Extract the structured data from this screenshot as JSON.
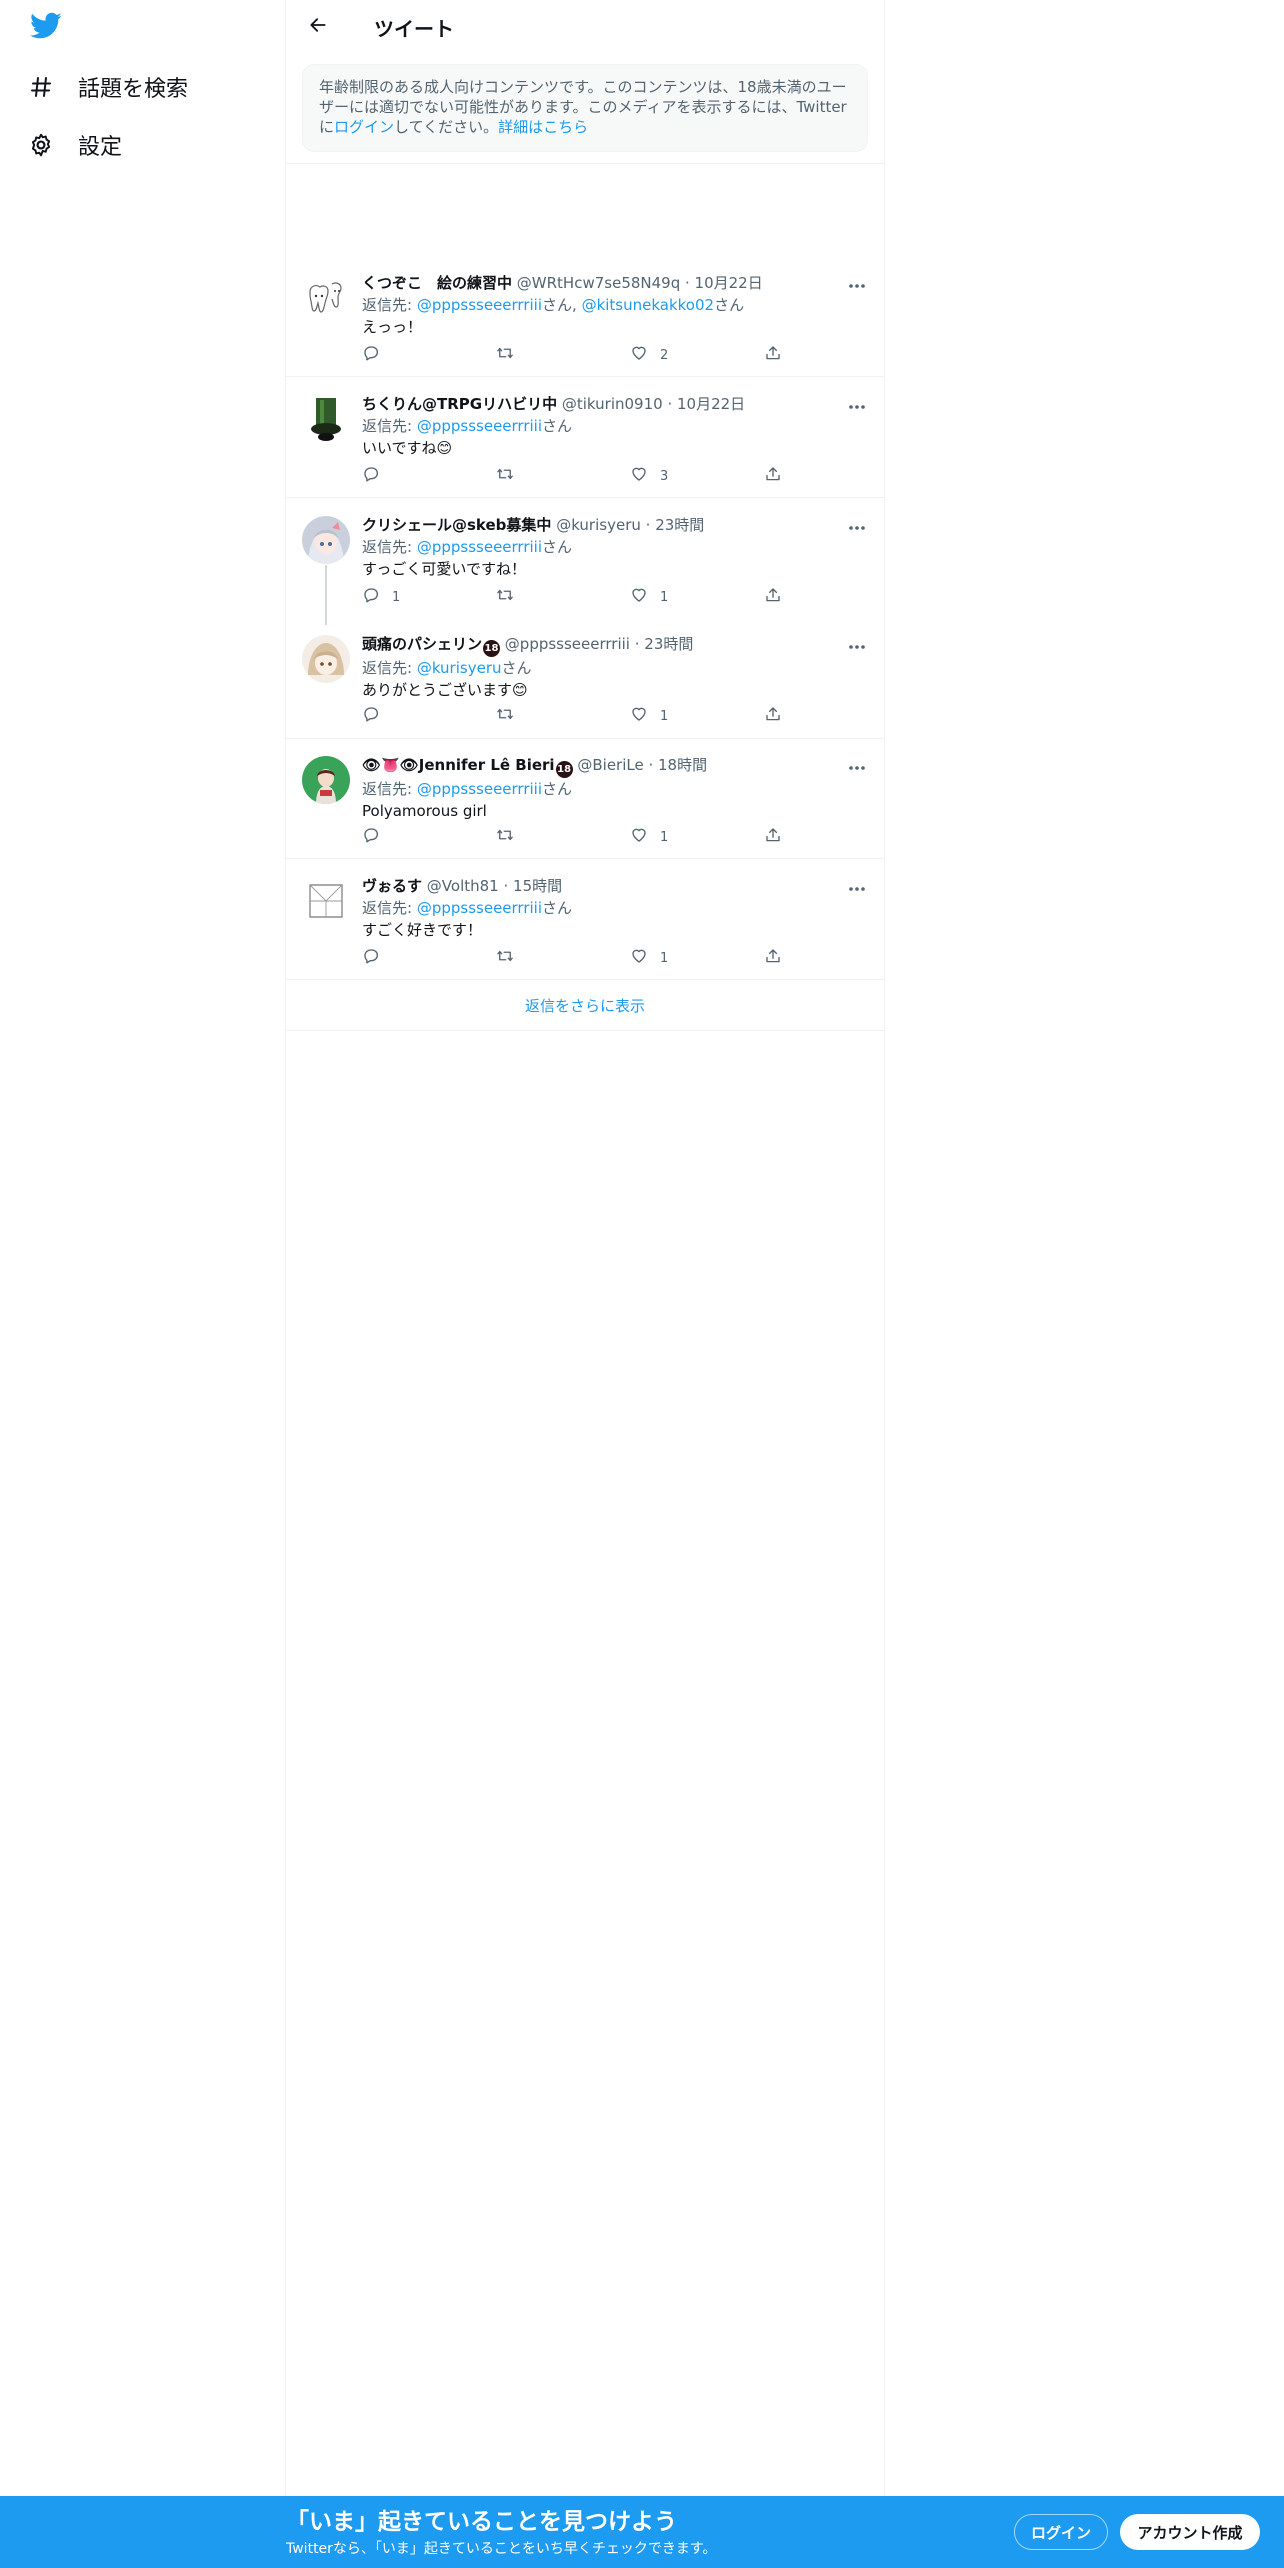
{
  "sidebar": {
    "logo": "twitter-bird-icon",
    "items": [
      {
        "icon": "hashtag-icon",
        "label": "話題を検索"
      },
      {
        "icon": "gear-icon",
        "label": "設定"
      }
    ]
  },
  "header": {
    "title": "ツイート",
    "back_icon": "arrow-left-icon"
  },
  "warning": {
    "text_a": "年齢制限のある成人向けコンテンツです。このコンテンツは、18歳未満のユー",
    "text_b": "ザーには適切でない可能性があります。このメディアを表示するには、Twitter",
    "text_c1": "に",
    "login_link": "ログイン",
    "text_c2": "してください。",
    "details_link": "詳細はこちら"
  },
  "reply_prefix": "返信先: ",
  "reply_suffix": "さん",
  "tweets": [
    {
      "name": "くつぞこ　絵の練習中",
      "handle": "@WRtHcw7se58N49q",
      "time": "10月22日",
      "mentions": [
        "@pppssseeerrriii",
        "@kitsunekakko02"
      ],
      "text": "えっっ！",
      "reply_count": "",
      "retweet_count": "",
      "like_count": "2"
    },
    {
      "name": "ちくりん@TRPGリハビリ中",
      "handle": "@tikurin0910",
      "time": "10月22日",
      "mentions": [
        "@pppssseeerrriii"
      ],
      "text": "いいですね😊",
      "reply_count": "",
      "retweet_count": "",
      "like_count": "3"
    },
    {
      "name": "クリシェール@skeb募集中",
      "handle": "@kurisyeru",
      "time": "23時間",
      "mentions": [
        "@pppssseeerrriii"
      ],
      "text": "すっごく可愛いですね！",
      "reply_count": "1",
      "retweet_count": "",
      "like_count": "1"
    },
    {
      "name": "頭痛のパシェリン",
      "badge": "18",
      "handle": "@pppssseeerrriii",
      "time": "23時間",
      "mentions": [
        "@kurisyeru"
      ],
      "text": "ありがとうございます😊",
      "reply_count": "",
      "retweet_count": "",
      "like_count": "1"
    },
    {
      "name": "👁👅👁Jennifer Lê Bieri",
      "badge": "18",
      "handle": "@BieriLe",
      "time": "18時間",
      "mentions": [
        "@pppssseeerrriii"
      ],
      "text": "Polyamorous girl",
      "reply_count": "",
      "retweet_count": "",
      "like_count": "1"
    },
    {
      "name": "ヴぉるす",
      "handle": "@Volth81",
      "time": "15時間",
      "mentions": [
        "@pppssseeerrriii"
      ],
      "text": "すごく好きです！",
      "reply_count": "",
      "retweet_count": "",
      "like_count": "1"
    }
  ],
  "show_more": "返信をさらに表示",
  "banner": {
    "title": "「いま」起きていることを見つけよう",
    "subtitle": "Twitterなら、「いま」起きていることをいち早くチェックできます。",
    "login": "ログイン",
    "signup": "アカウント作成"
  },
  "colors": {
    "accent": "#1d9bf0",
    "text": "#0f1419",
    "secondary": "#536471",
    "border": "#eff3f4"
  }
}
